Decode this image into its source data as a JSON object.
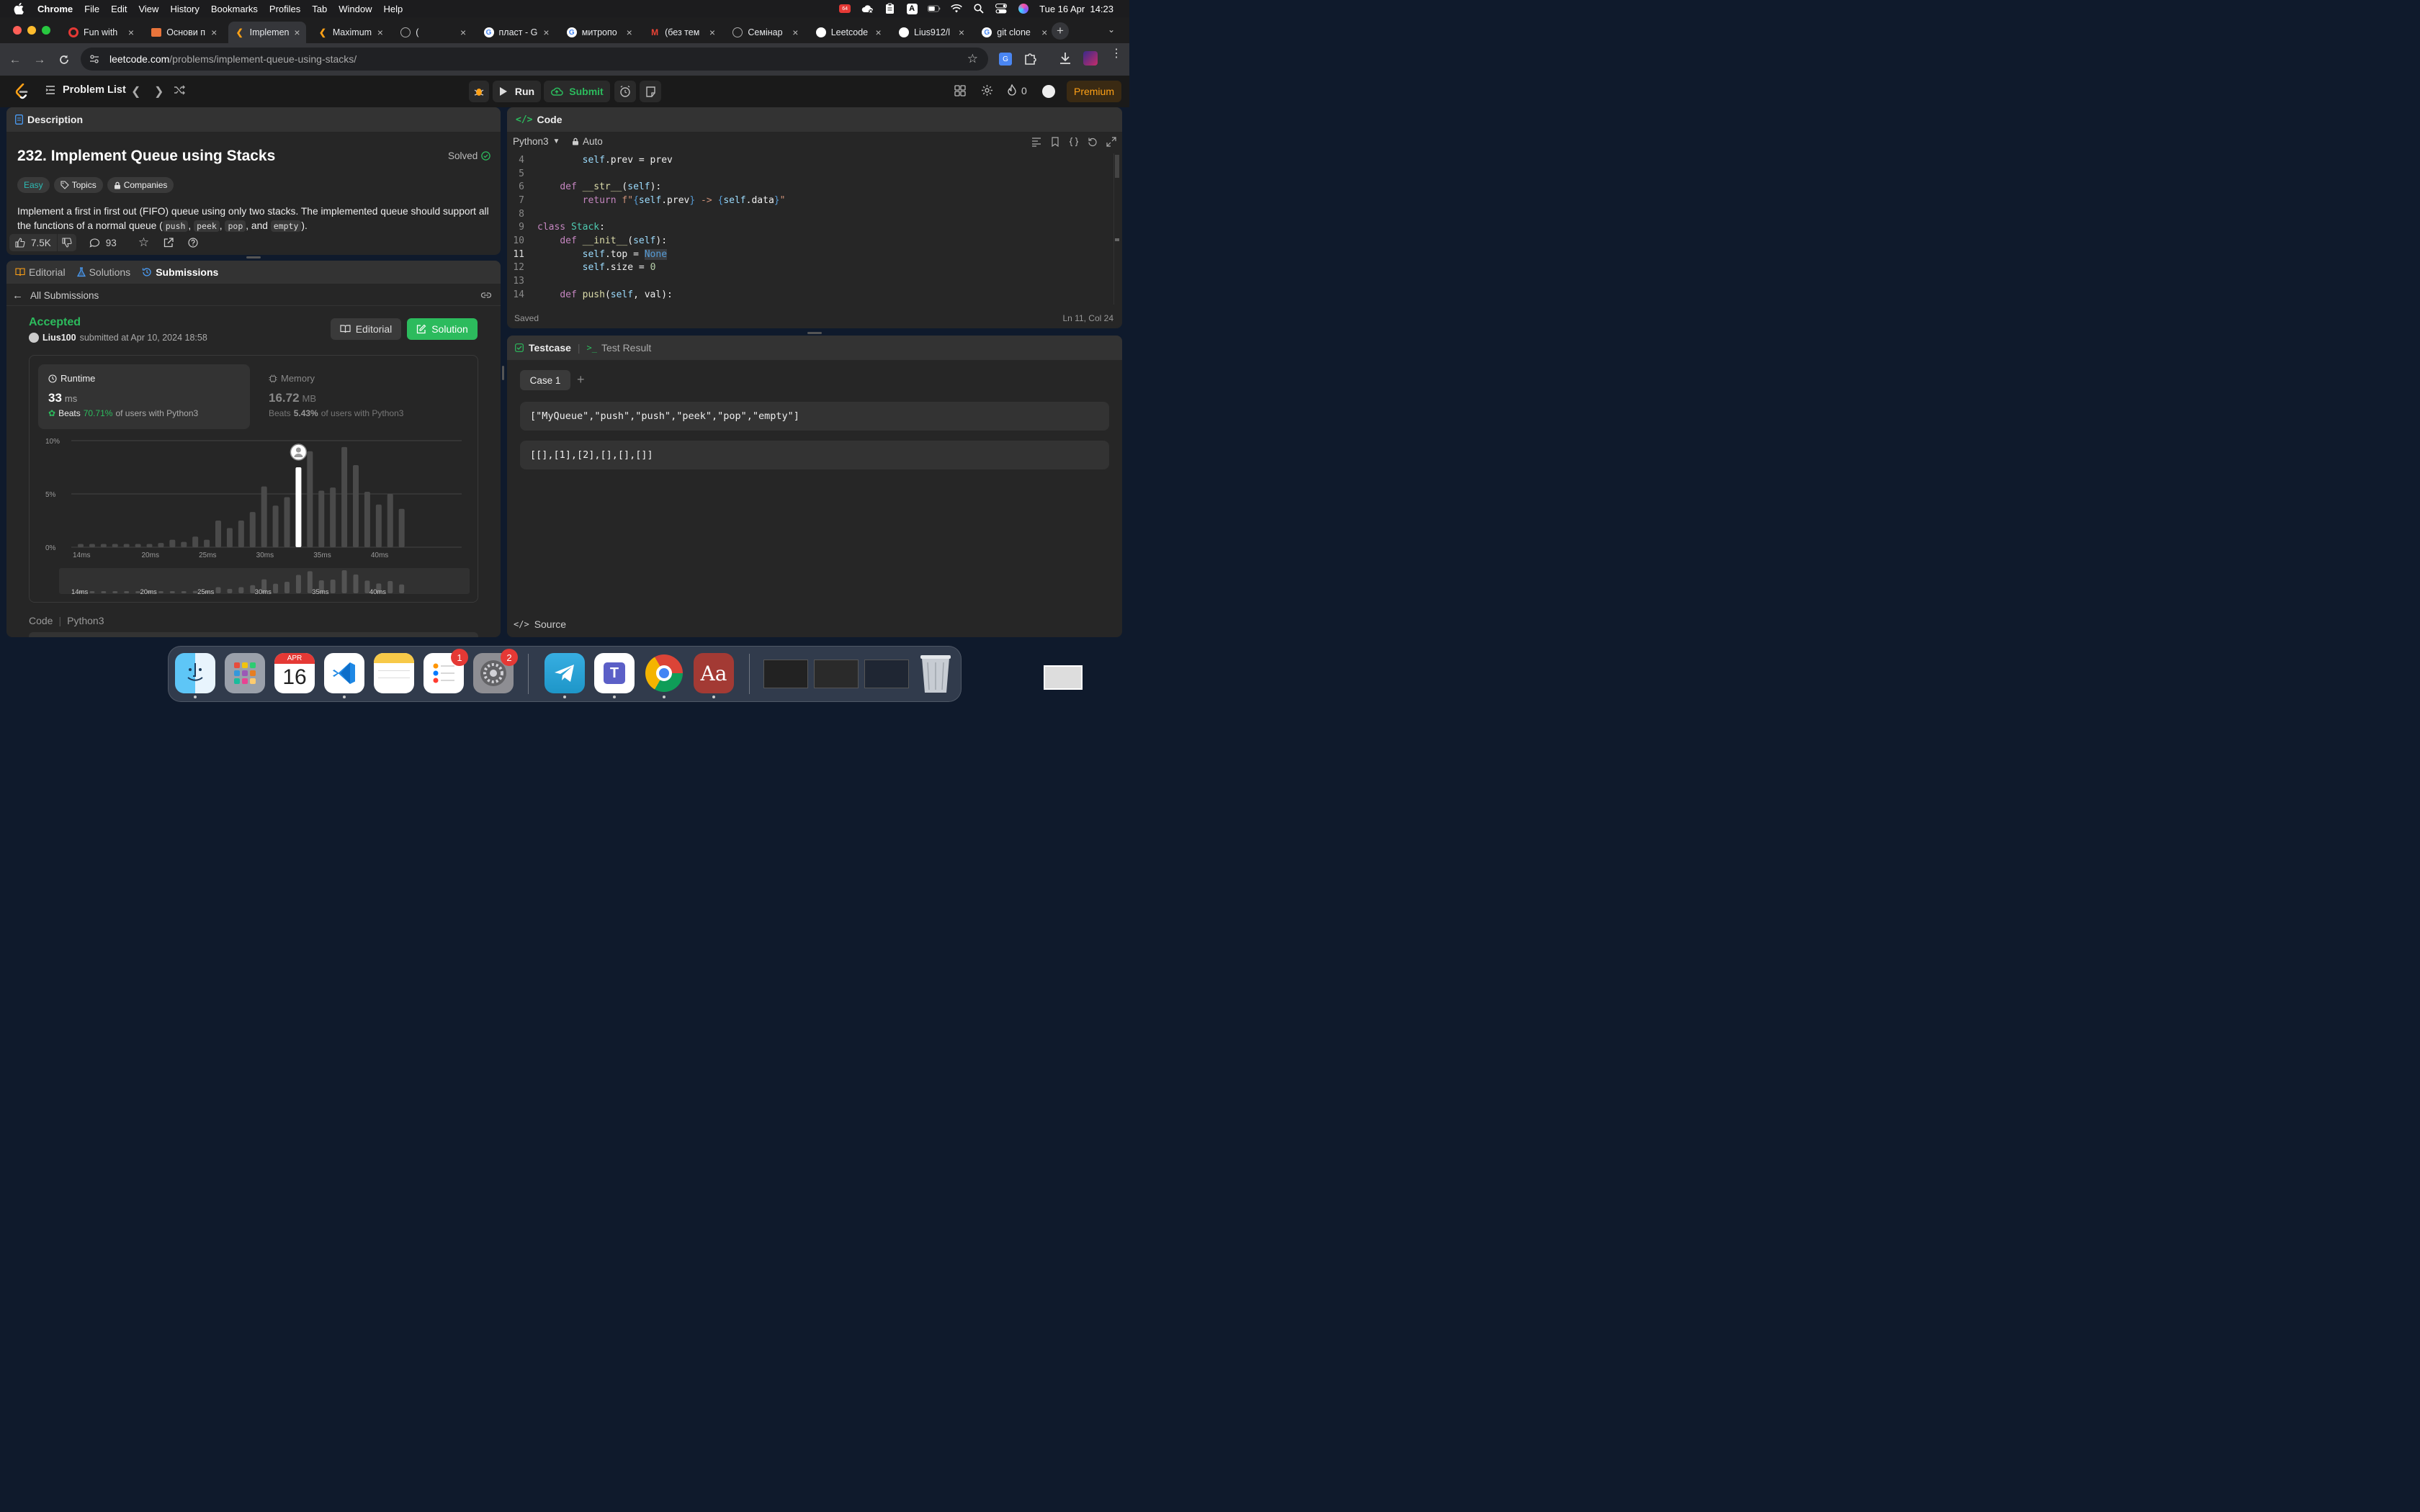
{
  "menubar": {
    "app_name": "Chrome",
    "items": [
      "File",
      "Edit",
      "View",
      "History",
      "Bookmarks",
      "Profiles",
      "Tab",
      "Window",
      "Help"
    ],
    "datetime": "Tue 16 Apr  14:23",
    "battery_badge": "64"
  },
  "browser": {
    "tabs": [
      {
        "title": "Fun with",
        "icon": "ring-icon",
        "active": false
      },
      {
        "title": "Основи п",
        "icon": "cube-icon",
        "active": false
      },
      {
        "title": "Implemen",
        "icon": "leetcode-icon",
        "active": true
      },
      {
        "title": "Maximum",
        "icon": "leetcode-icon",
        "active": false
      },
      {
        "title": "(",
        "icon": "globe-icon",
        "active": false
      },
      {
        "title": "пласт - G",
        "icon": "google-icon",
        "active": false
      },
      {
        "title": "митропо",
        "icon": "google-icon",
        "active": false
      },
      {
        "title": "(без тем",
        "icon": "gmail-icon",
        "active": false
      },
      {
        "title": "Семінар",
        "icon": "globe-icon",
        "active": false
      },
      {
        "title": "Leetcode",
        "icon": "github-icon",
        "active": false
      },
      {
        "title": "Lius912/l",
        "icon": "github-icon",
        "active": false
      },
      {
        "title": "git clone",
        "icon": "google-icon",
        "active": false
      }
    ],
    "url_domain": "leetcode.com",
    "url_path": "/problems/implement-queue-using-stacks/"
  },
  "lc_nav": {
    "problem_list": "Problem List",
    "run": "Run",
    "submit": "Submit",
    "streak": "0",
    "premium": "Premium"
  },
  "description": {
    "tab_label": "Description",
    "title": "232. Implement Queue using Stacks",
    "status": "Solved",
    "difficulty": "Easy",
    "topics": "Topics",
    "companies": "Companies",
    "text_1": "Implement a first in first out (FIFO) queue using only two stacks. The implemented queue should support all",
    "text_2": "the functions of a normal queue (",
    "fn_push": "push",
    "fn_peek": "peek",
    "fn_pop": "pop",
    "fn_empty": "empty",
    "text_and": ", and ",
    "text_end": ").",
    "likes": "7.5K",
    "comments": "93"
  },
  "submission": {
    "tabs": [
      "Editorial",
      "Solutions",
      "Submissions"
    ],
    "back_label": "All Submissions",
    "status": "Accepted",
    "user": "Lius100",
    "submitted_text": "submitted at Apr 10, 2024 18:58",
    "editorial_btn": "Editorial",
    "solution_btn": "Solution",
    "runtime": {
      "label": "Runtime",
      "value": "33",
      "unit": "ms",
      "beats_prefix": "Beats",
      "beats": "70.71%",
      "beats_suffix": "of users with Python3"
    },
    "memory": {
      "label": "Memory",
      "value": "16.72",
      "unit": "MB",
      "beats_prefix": "Beats",
      "beats": "5.43%",
      "beats_suffix": "of users with Python3"
    },
    "code_label": "Code",
    "lang": "Python3"
  },
  "chart_data": {
    "type": "bar",
    "title": "",
    "ylabel": "",
    "xlabel": "",
    "ylim": [
      0,
      10
    ],
    "y_ticks": [
      "0%",
      "5%",
      "10%"
    ],
    "x_ticks": [
      "14ms",
      "20ms",
      "25ms",
      "30ms",
      "35ms",
      "40ms"
    ],
    "x_tick_values": [
      14,
      20,
      25,
      30,
      35,
      40
    ],
    "x_values": [
      14,
      15,
      16,
      17,
      18,
      19,
      20,
      21,
      22,
      23,
      24,
      25,
      26,
      27,
      28,
      29,
      30,
      31,
      32,
      33,
      34,
      35,
      36,
      37,
      38,
      39,
      40,
      41,
      42
    ],
    "values": [
      0.3,
      0.3,
      0.3,
      0.3,
      0.3,
      0.3,
      0.3,
      0.4,
      0.7,
      0.5,
      1.0,
      0.7,
      2.5,
      1.8,
      2.5,
      3.3,
      5.7,
      3.9,
      4.7,
      7.5,
      9.0,
      5.3,
      5.6,
      9.4,
      7.7,
      5.2,
      4.0,
      5.0,
      3.6
    ],
    "highlight_x": 33,
    "grid": true
  },
  "code_panel": {
    "tab_label": "Code",
    "lang": "Python3",
    "mode": "Auto",
    "saved": "Saved",
    "cursor": "Ln 11, Col 24",
    "lines": [
      {
        "n": "4",
        "text": "        self.prev = prev"
      },
      {
        "n": "5",
        "text": ""
      },
      {
        "n": "6",
        "text": "    def __str__(self):"
      },
      {
        "n": "7",
        "text": "        return f\"{self.prev} -> {self.data}\""
      },
      {
        "n": "8",
        "text": ""
      },
      {
        "n": "9",
        "text": "class Stack:"
      },
      {
        "n": "10",
        "text": "    def __init__(self):"
      },
      {
        "n": "11",
        "text": "        self.top = None"
      },
      {
        "n": "12",
        "text": "        self.size = 0"
      },
      {
        "n": "13",
        "text": ""
      },
      {
        "n": "14",
        "text": "    def push(self, val):"
      }
    ]
  },
  "testcase": {
    "tab_label": "Testcase",
    "result_label": "Test Result",
    "case_label": "Case 1",
    "input_1": "[\"MyQueue\",\"push\",\"push\",\"peek\",\"pop\",\"empty\"]",
    "input_2": "[[],[1],[2],[],[],[]]",
    "source": "Source"
  },
  "dock": {
    "calendar_month": "APR",
    "calendar_day": "16",
    "reminders_badge": "1",
    "settings_badge": "2"
  }
}
